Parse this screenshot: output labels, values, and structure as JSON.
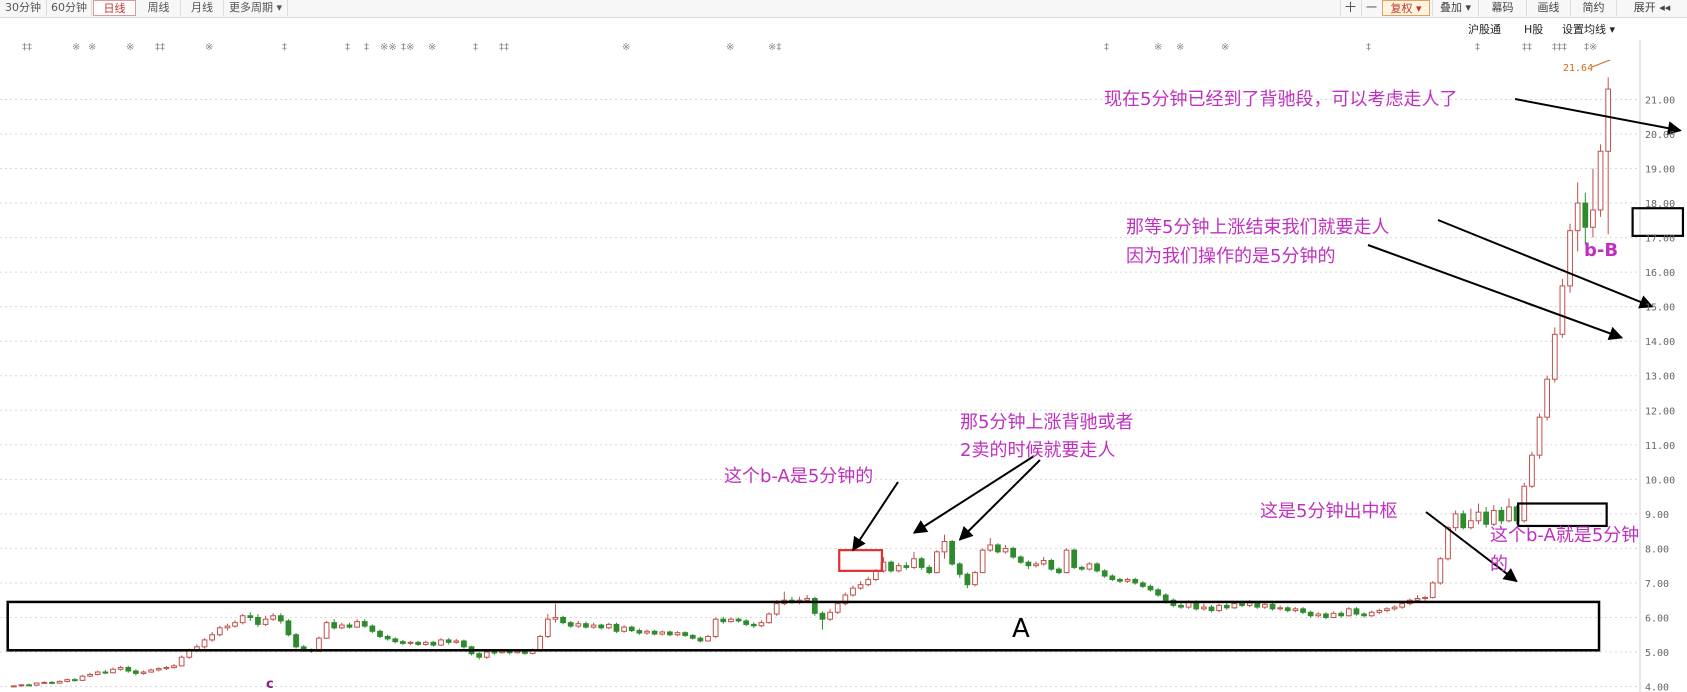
{
  "toolbar": {
    "periods": [
      "30分钟",
      "60分钟",
      "日线",
      "周线",
      "月线",
      "更多周期 ▾"
    ],
    "active_period": "日线",
    "right_buttons": [
      "十",
      "一",
      "复权 ▾",
      "叠加 ▾",
      "幕码",
      "画线",
      "简约",
      "展开 ◂◂"
    ]
  },
  "subbar": {
    "hsgt": "沪股通",
    "hk": "H股",
    "ma_setting": "设置均线 ▾"
  },
  "chart_data": {
    "type": "candlestick",
    "ylim": [
      3.9,
      22.2
    ],
    "y_ticks": [
      "4.00",
      "5.00",
      "6.00",
      "7.00",
      "8.00",
      "9.00",
      "10.00",
      "11.00",
      "12.00",
      "13.00",
      "14.00",
      "15.00",
      "16.00",
      "17.00",
      "18.00",
      "19.00",
      "20.00",
      "21.00"
    ],
    "max_label": "21.64",
    "up_color": "#c0504d",
    "down_color": "#2e8b2e",
    "bottom_marker": "c",
    "candles": [
      [
        4.0,
        4.02,
        4.03,
        3.98
      ],
      [
        4.02,
        4.05,
        4.07,
        4.0
      ],
      [
        4.05,
        4.04,
        4.08,
        4.01
      ],
      [
        4.04,
        4.1,
        4.12,
        4.02
      ],
      [
        4.1,
        4.12,
        4.15,
        4.08
      ],
      [
        4.12,
        4.1,
        4.16,
        4.07
      ],
      [
        4.1,
        4.15,
        4.18,
        4.08
      ],
      [
        4.15,
        4.2,
        4.23,
        4.12
      ],
      [
        4.2,
        4.18,
        4.24,
        4.14
      ],
      [
        4.18,
        4.3,
        4.34,
        4.16
      ],
      [
        4.3,
        4.35,
        4.4,
        4.27
      ],
      [
        4.35,
        4.42,
        4.46,
        4.32
      ],
      [
        4.42,
        4.4,
        4.48,
        4.36
      ],
      [
        4.4,
        4.5,
        4.55,
        4.38
      ],
      [
        4.5,
        4.55,
        4.6,
        4.46
      ],
      [
        4.55,
        4.45,
        4.6,
        4.4
      ],
      [
        4.45,
        4.38,
        4.5,
        4.32
      ],
      [
        4.38,
        4.42,
        4.46,
        4.34
      ],
      [
        4.42,
        4.48,
        4.52,
        4.4
      ],
      [
        4.48,
        4.52,
        4.56,
        4.44
      ],
      [
        4.52,
        4.55,
        4.6,
        4.48
      ],
      [
        4.55,
        4.6,
        4.65,
        4.52
      ],
      [
        4.6,
        4.85,
        4.9,
        4.58
      ],
      [
        4.85,
        5.05,
        5.1,
        4.8
      ],
      [
        5.05,
        5.15,
        5.22,
        5.0
      ],
      [
        5.15,
        5.35,
        5.4,
        5.1
      ],
      [
        5.35,
        5.5,
        5.58,
        5.3
      ],
      [
        5.5,
        5.7,
        5.76,
        5.45
      ],
      [
        5.7,
        5.75,
        5.82,
        5.62
      ],
      [
        5.75,
        5.85,
        5.92,
        5.7
      ],
      [
        5.85,
        6.05,
        6.1,
        5.8
      ],
      [
        6.05,
        6.0,
        6.15,
        5.9
      ],
      [
        6.0,
        5.8,
        6.1,
        5.72
      ],
      [
        5.8,
        5.95,
        6.05,
        5.75
      ],
      [
        5.95,
        6.05,
        6.12,
        5.9
      ],
      [
        6.05,
        5.9,
        6.12,
        5.82
      ],
      [
        5.9,
        5.5,
        5.95,
        5.45
      ],
      [
        5.5,
        5.15,
        5.55,
        5.1
      ],
      [
        5.15,
        5.05,
        5.2,
        5.0
      ],
      [
        5.05,
        5.02,
        5.1,
        4.98
      ],
      [
        5.02,
        5.4,
        5.45,
        5.0
      ],
      [
        5.4,
        5.85,
        5.9,
        5.38
      ],
      [
        5.85,
        5.7,
        5.95,
        5.65
      ],
      [
        5.7,
        5.78,
        5.85,
        5.66
      ],
      [
        5.78,
        5.72,
        5.85,
        5.68
      ],
      [
        5.72,
        5.88,
        5.95,
        5.7
      ],
      [
        5.88,
        5.75,
        5.95,
        5.7
      ],
      [
        5.75,
        5.6,
        5.8,
        5.55
      ],
      [
        5.6,
        5.45,
        5.65,
        5.4
      ],
      [
        5.45,
        5.38,
        5.5,
        5.33
      ],
      [
        5.38,
        5.3,
        5.42,
        5.25
      ],
      [
        5.3,
        5.25,
        5.35,
        5.2
      ],
      [
        5.25,
        5.28,
        5.32,
        5.2
      ],
      [
        5.28,
        5.22,
        5.32,
        5.18
      ],
      [
        5.22,
        5.28,
        5.33,
        5.18
      ],
      [
        5.28,
        5.2,
        5.32,
        5.16
      ],
      [
        5.2,
        5.35,
        5.4,
        5.18
      ],
      [
        5.35,
        5.28,
        5.4,
        5.22
      ],
      [
        5.28,
        5.32,
        5.38,
        5.24
      ],
      [
        5.32,
        5.15,
        5.36,
        5.1
      ],
      [
        5.15,
        4.95,
        5.18,
        4.9
      ],
      [
        4.95,
        4.85,
        5.0,
        4.78
      ],
      [
        4.85,
        5.0,
        5.05,
        4.8
      ],
      [
        5.0,
        4.98,
        5.05,
        4.92
      ],
      [
        4.98,
        5.02,
        5.08,
        4.95
      ],
      [
        5.02,
        4.98,
        5.05,
        4.93
      ],
      [
        4.98,
        5.02,
        5.06,
        4.95
      ],
      [
        5.02,
        4.96,
        5.06,
        4.92
      ],
      [
        4.96,
        5.05,
        5.1,
        4.93
      ],
      [
        5.05,
        5.45,
        5.5,
        5.0
      ],
      [
        5.45,
        5.95,
        6.1,
        5.4
      ],
      [
        5.95,
        6.0,
        6.4,
        5.85
      ],
      [
        6.0,
        5.85,
        6.05,
        5.8
      ],
      [
        5.85,
        5.75,
        5.9,
        5.7
      ],
      [
        5.75,
        5.82,
        5.9,
        5.7
      ],
      [
        5.82,
        5.72,
        5.88,
        5.68
      ],
      [
        5.72,
        5.78,
        5.85,
        5.68
      ],
      [
        5.78,
        5.7,
        5.82,
        5.65
      ],
      [
        5.7,
        5.8,
        5.85,
        5.66
      ],
      [
        5.8,
        5.6,
        5.85,
        5.55
      ],
      [
        5.6,
        5.72,
        5.78,
        5.56
      ],
      [
        5.72,
        5.62,
        5.76,
        5.58
      ],
      [
        5.62,
        5.55,
        5.68,
        5.5
      ],
      [
        5.55,
        5.6,
        5.65,
        5.5
      ],
      [
        5.6,
        5.52,
        5.64,
        5.48
      ],
      [
        5.52,
        5.58,
        5.62,
        5.48
      ],
      [
        5.58,
        5.5,
        5.62,
        5.46
      ],
      [
        5.5,
        5.56,
        5.6,
        5.46
      ],
      [
        5.56,
        5.48,
        5.6,
        5.44
      ],
      [
        5.48,
        5.4,
        5.52,
        5.36
      ],
      [
        5.4,
        5.32,
        5.45,
        5.28
      ],
      [
        5.32,
        5.45,
        5.5,
        5.3
      ],
      [
        5.45,
        5.95,
        6.0,
        5.4
      ],
      [
        5.95,
        5.88,
        6.02,
        5.82
      ],
      [
        5.88,
        5.95,
        6.0,
        5.85
      ],
      [
        5.95,
        5.9,
        6.0,
        5.85
      ],
      [
        5.9,
        5.8,
        5.95,
        5.75
      ],
      [
        5.8,
        5.76,
        5.86,
        5.7
      ],
      [
        5.76,
        5.85,
        5.92,
        5.72
      ],
      [
        5.85,
        6.1,
        6.15,
        5.82
      ],
      [
        6.1,
        6.4,
        6.5,
        6.05
      ],
      [
        6.4,
        6.5,
        6.75,
        6.35
      ],
      [
        6.5,
        6.45,
        6.6,
        6.4
      ],
      [
        6.45,
        6.5,
        6.6,
        6.38
      ],
      [
        6.5,
        6.55,
        6.65,
        6.45
      ],
      [
        6.55,
        6.12,
        6.6,
        6.05
      ],
      [
        6.12,
        5.95,
        6.18,
        5.65
      ],
      [
        5.95,
        6.15,
        6.25,
        5.9
      ],
      [
        6.15,
        6.4,
        6.45,
        6.1
      ],
      [
        6.4,
        6.65,
        6.72,
        6.35
      ],
      [
        6.65,
        6.85,
        6.92,
        6.6
      ],
      [
        6.85,
        6.95,
        7.05,
        6.8
      ],
      [
        6.95,
        7.1,
        7.18,
        6.9
      ],
      [
        7.1,
        7.35,
        7.4,
        7.05
      ],
      [
        7.35,
        7.6,
        7.75,
        7.3
      ],
      [
        7.6,
        7.35,
        7.65,
        7.3
      ],
      [
        7.35,
        7.5,
        7.58,
        7.3
      ],
      [
        7.5,
        7.45,
        7.6,
        7.38
      ],
      [
        7.45,
        7.7,
        7.9,
        7.4
      ],
      [
        7.7,
        7.45,
        7.75,
        7.38
      ],
      [
        7.45,
        7.3,
        7.52,
        7.25
      ],
      [
        7.3,
        7.9,
        7.95,
        7.28
      ],
      [
        7.9,
        8.2,
        8.4,
        7.7
      ],
      [
        8.2,
        7.55,
        8.25,
        7.5
      ],
      [
        7.55,
        7.25,
        7.6,
        7.15
      ],
      [
        7.25,
        6.95,
        7.3,
        6.85
      ],
      [
        6.95,
        7.3,
        7.35,
        6.9
      ],
      [
        7.3,
        7.95,
        8.0,
        7.28
      ],
      [
        7.95,
        8.1,
        8.3,
        7.9
      ],
      [
        8.1,
        7.9,
        8.15,
        7.85
      ],
      [
        7.9,
        8.0,
        8.1,
        7.85
      ],
      [
        8.0,
        7.75,
        8.05,
        7.7
      ],
      [
        7.75,
        7.6,
        7.8,
        7.55
      ],
      [
        7.6,
        7.5,
        7.65,
        7.4
      ],
      [
        7.5,
        7.55,
        7.62,
        7.45
      ],
      [
        7.55,
        7.65,
        7.75,
        7.5
      ],
      [
        7.65,
        7.4,
        7.7,
        7.35
      ],
      [
        7.4,
        7.3,
        7.45,
        7.25
      ],
      [
        7.3,
        7.95,
        8.0,
        7.28
      ],
      [
        7.95,
        7.45,
        8.0,
        7.4
      ],
      [
        7.45,
        7.4,
        7.5,
        7.35
      ],
      [
        7.4,
        7.55,
        7.6,
        7.36
      ],
      [
        7.55,
        7.35,
        7.6,
        7.3
      ],
      [
        7.35,
        7.2,
        7.4,
        7.15
      ],
      [
        7.2,
        7.1,
        7.25,
        7.05
      ],
      [
        7.1,
        7.05,
        7.15,
        7.0
      ],
      [
        7.05,
        7.1,
        7.15,
        7.0
      ],
      [
        7.1,
        7.0,
        7.15,
        6.95
      ],
      [
        7.0,
        6.9,
        7.05,
        6.85
      ],
      [
        6.9,
        6.8,
        6.95,
        6.75
      ],
      [
        6.8,
        6.65,
        6.85,
        6.6
      ],
      [
        6.65,
        6.5,
        6.7,
        6.4
      ],
      [
        6.5,
        6.35,
        6.55,
        6.3
      ],
      [
        6.35,
        6.3,
        6.42,
        6.25
      ],
      [
        6.3,
        6.45,
        6.5,
        6.25
      ],
      [
        6.45,
        6.25,
        6.5,
        6.2
      ],
      [
        6.25,
        6.3,
        6.4,
        6.2
      ],
      [
        6.3,
        6.2,
        6.36,
        6.15
      ],
      [
        6.2,
        6.35,
        6.4,
        6.15
      ],
      [
        6.35,
        6.28,
        6.45,
        6.22
      ],
      [
        6.28,
        6.4,
        6.45,
        6.25
      ],
      [
        6.4,
        6.35,
        6.48,
        6.3
      ],
      [
        6.35,
        6.42,
        6.5,
        6.3
      ],
      [
        6.42,
        6.3,
        6.48,
        6.25
      ],
      [
        6.3,
        6.38,
        6.45,
        6.25
      ],
      [
        6.38,
        6.25,
        6.42,
        6.2
      ],
      [
        6.25,
        6.28,
        6.35,
        6.2
      ],
      [
        6.28,
        6.2,
        6.32,
        6.15
      ],
      [
        6.2,
        6.25,
        6.3,
        6.15
      ],
      [
        6.25,
        6.15,
        6.3,
        6.1
      ],
      [
        6.15,
        6.05,
        6.2,
        6.0
      ],
      [
        6.05,
        6.1,
        6.15,
        6.0
      ],
      [
        6.1,
        6.0,
        6.15,
        5.95
      ],
      [
        6.0,
        6.12,
        6.18,
        5.98
      ],
      [
        6.12,
        6.05,
        6.18,
        6.0
      ],
      [
        6.05,
        6.25,
        6.3,
        6.02
      ],
      [
        6.25,
        6.1,
        6.3,
        6.05
      ],
      [
        6.1,
        6.05,
        6.15,
        6.0
      ],
      [
        6.05,
        6.15,
        6.2,
        6.02
      ],
      [
        6.15,
        6.2,
        6.25,
        6.1
      ],
      [
        6.2,
        6.25,
        6.3,
        6.15
      ],
      [
        6.25,
        6.3,
        6.35,
        6.2
      ],
      [
        6.3,
        6.4,
        6.45,
        6.25
      ],
      [
        6.4,
        6.5,
        6.55,
        6.35
      ],
      [
        6.5,
        6.55,
        6.65,
        6.45
      ],
      [
        6.55,
        6.58,
        6.62,
        6.48
      ],
      [
        6.58,
        7.0,
        7.05,
        6.55
      ],
      [
        7.0,
        7.7,
        7.75,
        6.95
      ],
      [
        7.7,
        8.6,
        8.65,
        7.65
      ],
      [
        8.6,
        9.0,
        9.1,
        8.5
      ],
      [
        9.0,
        8.6,
        9.1,
        8.55
      ],
      [
        8.6,
        8.8,
        9.15,
        8.55
      ],
      [
        8.8,
        9.05,
        9.3,
        8.7
      ],
      [
        9.05,
        8.7,
        9.2,
        8.6
      ],
      [
        8.7,
        9.1,
        9.25,
        8.65
      ],
      [
        9.1,
        8.8,
        9.2,
        8.7
      ],
      [
        8.8,
        9.2,
        9.45,
        8.75
      ],
      [
        9.2,
        8.8,
        9.25,
        8.7
      ],
      [
        8.8,
        9.8,
        9.9,
        8.75
      ],
      [
        9.8,
        10.7,
        10.8,
        9.75
      ],
      [
        10.7,
        11.8,
        11.9,
        10.6
      ],
      [
        11.8,
        12.9,
        13.0,
        11.7
      ],
      [
        12.9,
        14.2,
        14.4,
        12.8
      ],
      [
        14.2,
        15.6,
        15.8,
        14.1
      ],
      [
        15.6,
        17.2,
        17.4,
        15.4
      ],
      [
        17.2,
        18.0,
        18.6,
        16.6
      ],
      [
        18.0,
        17.3,
        18.3,
        16.8
      ],
      [
        17.3,
        17.8,
        19.0,
        17.0
      ],
      [
        17.8,
        19.5,
        19.7,
        17.6
      ],
      [
        19.5,
        21.3,
        21.64,
        17.1
      ]
    ],
    "zhongshu_boxes": [
      {
        "label": "A",
        "x_range": [
          0,
          207
        ],
        "y_range": [
          5.05,
          6.45
        ]
      },
      {
        "x_range": [
          109,
          113
        ],
        "y_range": [
          7.35,
          7.95
        ]
      },
      {
        "x_range": [
          198,
          208
        ],
        "y_range": [
          8.65,
          9.3
        ]
      },
      {
        "x_range": [
          213,
          218
        ],
        "y_range": [
          17.05,
          17.85
        ]
      }
    ],
    "annotations": [
      {
        "text": "现在5分钟已经到了背驰段，可以考虑走人了"
      },
      {
        "text": "那等5分钟上涨结束我们就要走人"
      },
      {
        "text": "因为我们操作的是5分钟的"
      },
      {
        "text": "b-B"
      },
      {
        "text": "那5分钟上涨背驰或者"
      },
      {
        "text": "2卖的时候就要走人"
      },
      {
        "text": "这个b-A是5分钟的"
      },
      {
        "text": "这是5分钟出中枢"
      },
      {
        "text": "这个b-A就是5分钟"
      },
      {
        "text": "的"
      },
      {
        "text": "A"
      }
    ]
  }
}
